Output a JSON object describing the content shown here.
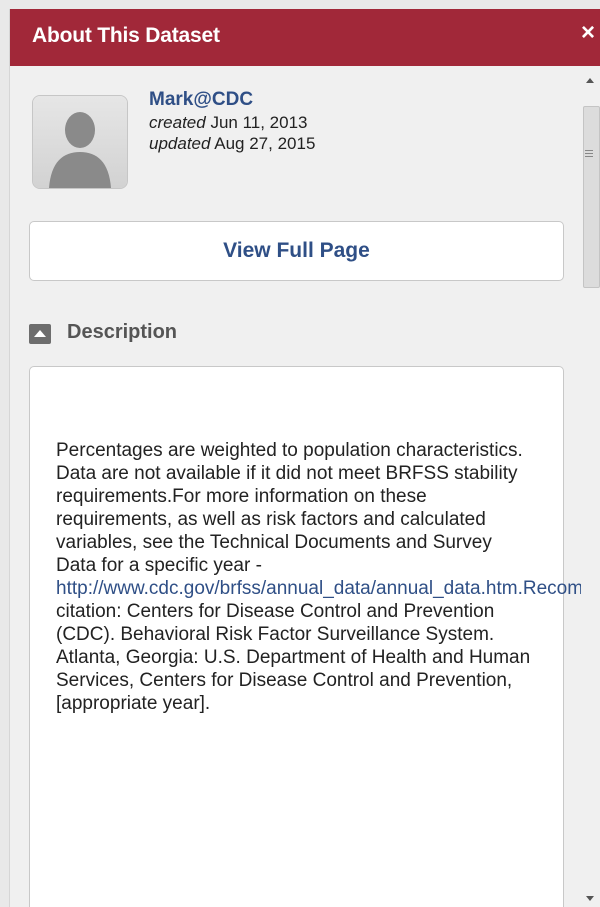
{
  "header": {
    "title": "About This Dataset",
    "close_symbol": "×"
  },
  "author": {
    "name": "Mark@CDC",
    "created_label": "created",
    "created_date": "Jun 11, 2013",
    "updated_label": "updated",
    "updated_date": "Aug 27, 2015",
    "avatar_icon": "user-silhouette-icon"
  },
  "actions": {
    "view_full_page": "View Full Page"
  },
  "description": {
    "heading": "Description",
    "toggle_icon": "collapse-arrow-icon",
    "text_before_link": "Percentages are weighted to population characteristics. Data are not available if it did not meet BRFSS stability requirements.For more information on these requirements, as well as risk factors and calculated variables, see the Technical Documents and Survey Data for a specific year - ",
    "link_text": "http://www.cdc.gov/brfss/annual_data/annual_data.htm.Recommended",
    "text_after_link": " citation: Centers for Disease Control and Prevention (CDC). Behavioral Risk Factor Surveillance System. Atlanta, Georgia: U.S. Department of Health and Human Services, Centers for Disease Control and Prevention, [appropriate year]."
  },
  "colors": {
    "header_bg": "#a12839",
    "link": "#2f4f86"
  }
}
